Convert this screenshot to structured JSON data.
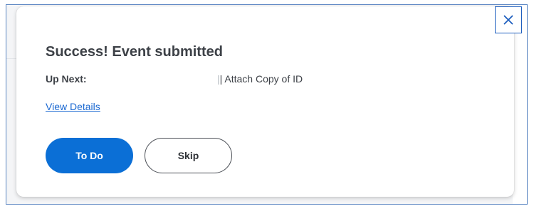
{
  "dialog": {
    "title": "Success! Event submitted",
    "up_next_label": "Up Next:",
    "up_next_separator": "|",
    "up_next_value": "| Attach Copy of ID",
    "view_details_label": "View Details",
    "close_icon": "close-icon"
  },
  "actions": {
    "todo_label": "To Do",
    "skip_label": "Skip"
  },
  "colors": {
    "primary": "#0b6fd6",
    "link": "#1a68d1",
    "text": "#3d4147",
    "focus_border": "#1e5fbf"
  }
}
